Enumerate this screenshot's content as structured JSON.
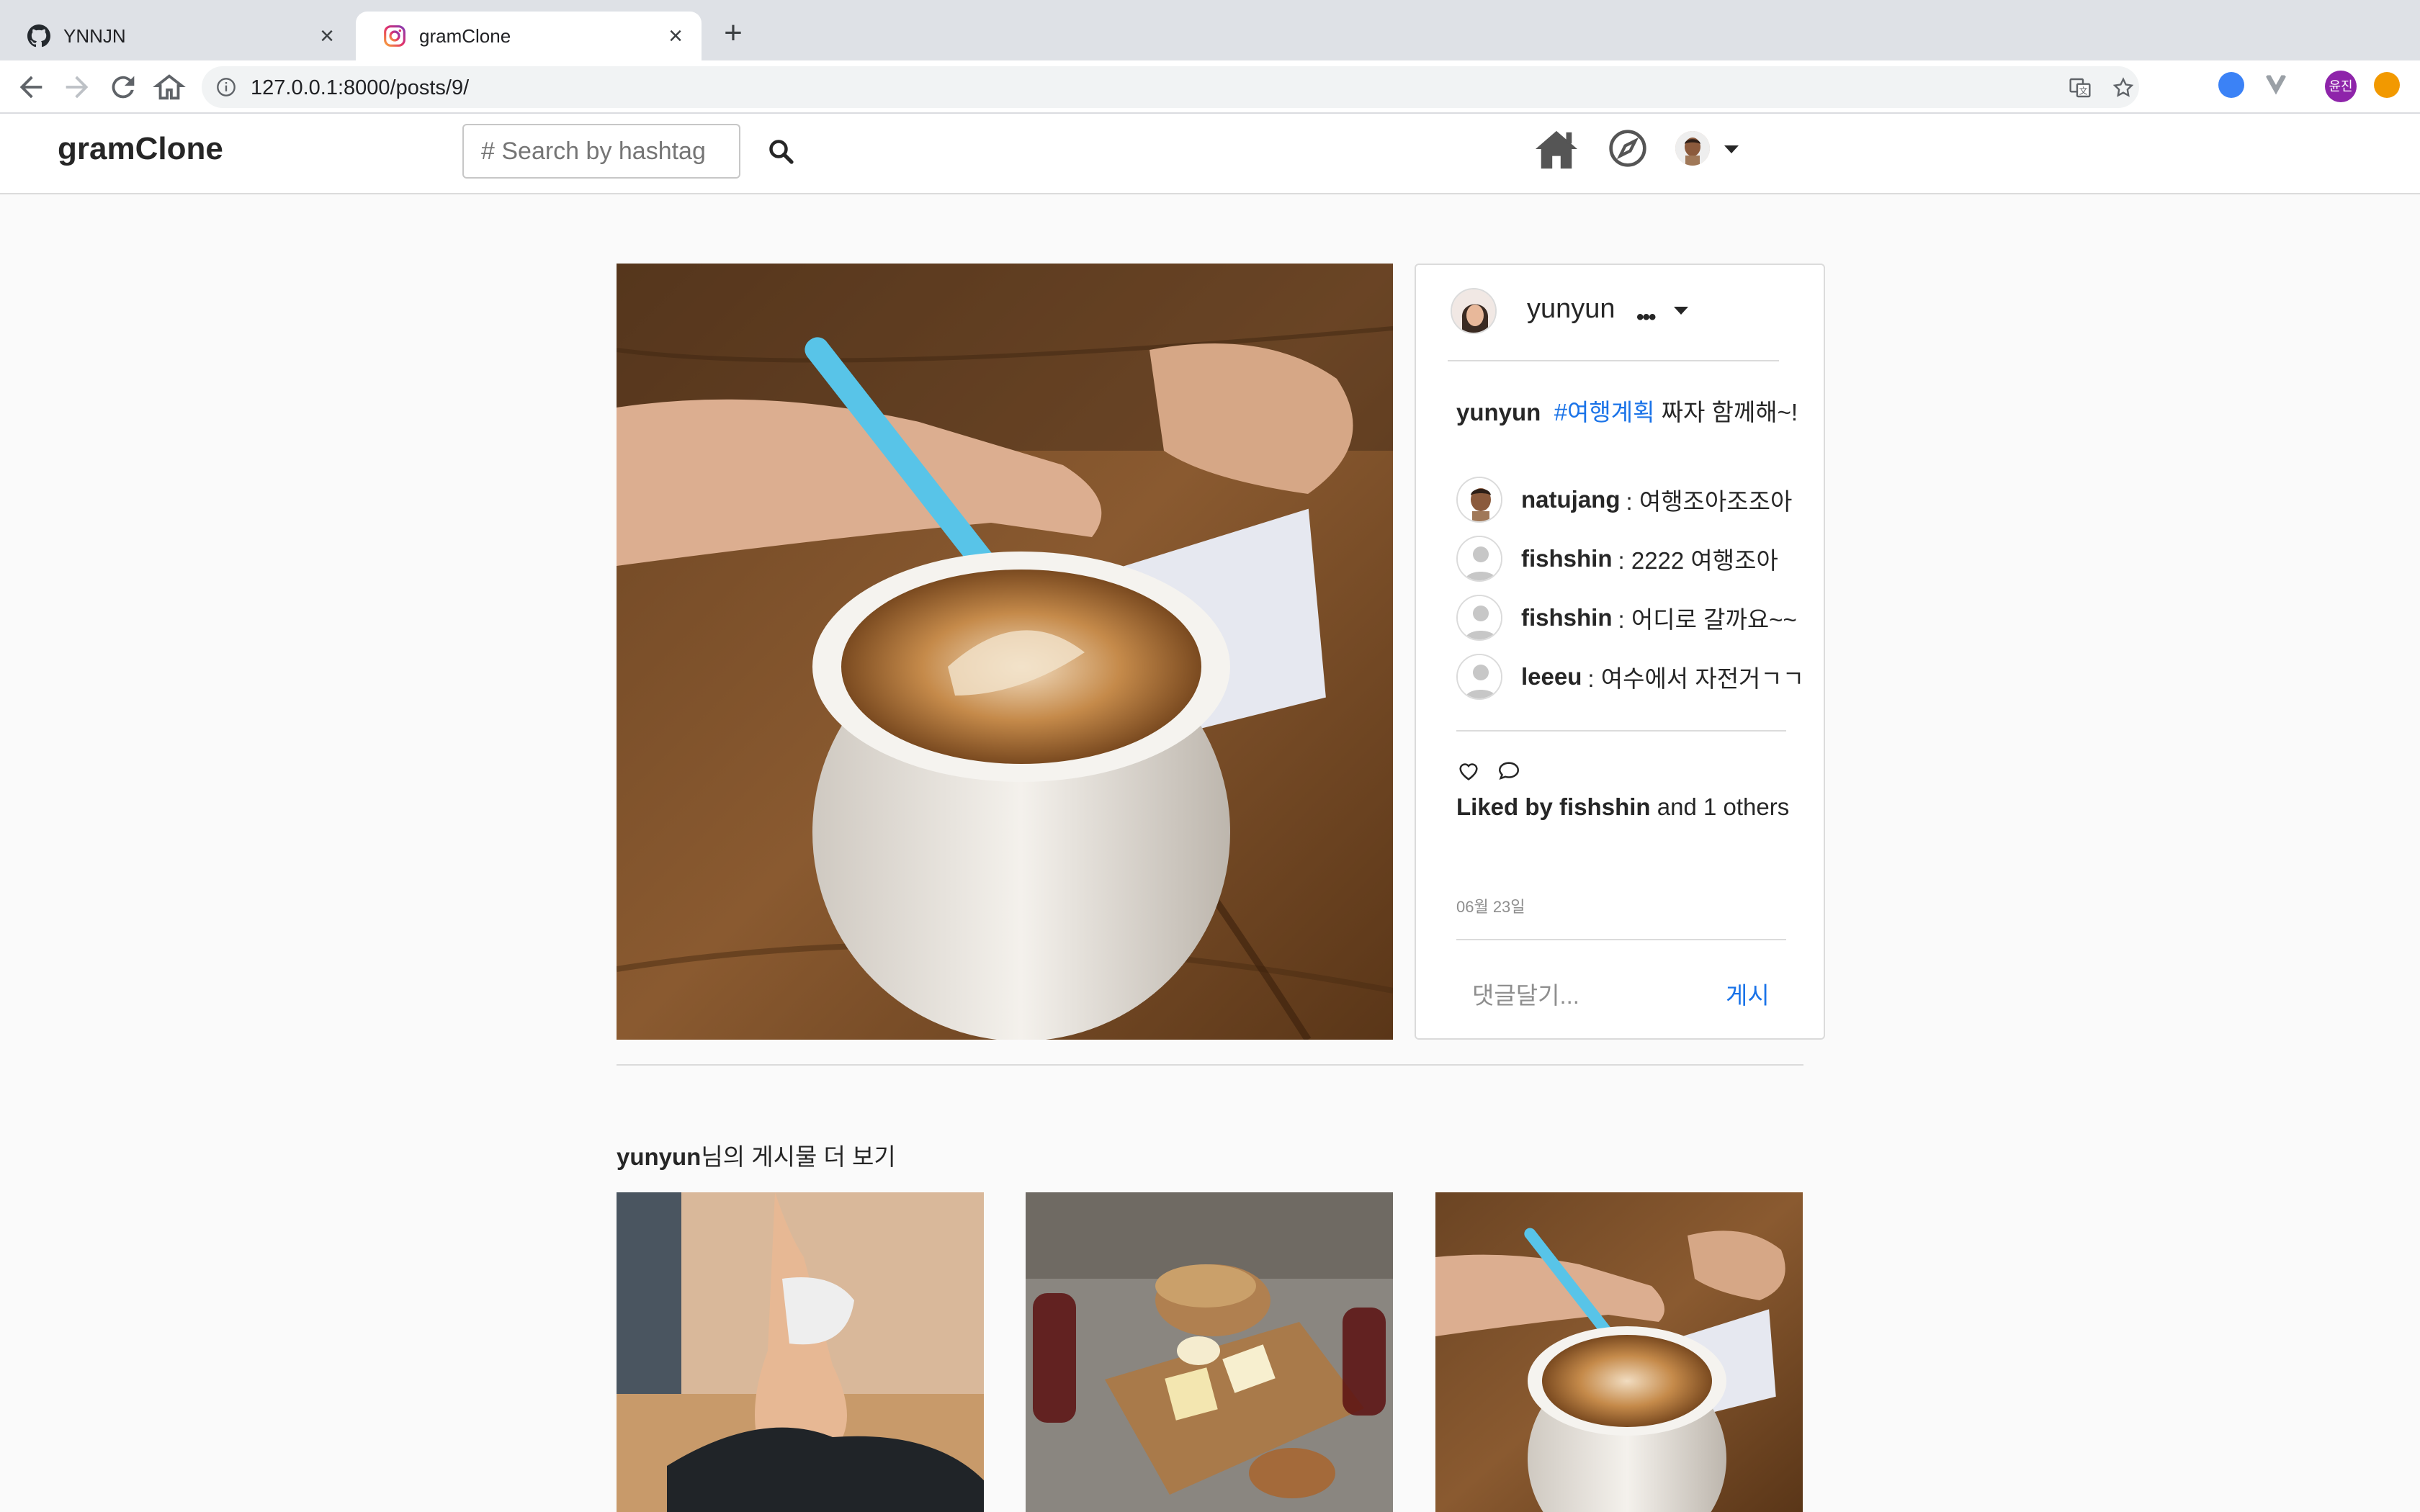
{
  "browser": {
    "tabs": [
      {
        "title": "YNNJN",
        "active": false,
        "icon": "github-icon"
      },
      {
        "title": "gramClone",
        "active": true,
        "icon": "instagram-icon"
      }
    ],
    "url": "127.0.0.1:8000/posts/9/",
    "profile_label": "윤진"
  },
  "navbar": {
    "brand": "gramClone",
    "search_placeholder": "# Search by hashtag"
  },
  "post": {
    "author": "yunyun",
    "caption": {
      "author": "yunyun",
      "hashtag": "#여행계획",
      "text": "짜자 함께해~!"
    },
    "comments": [
      {
        "user": "natujang",
        "text": ": 여행조아조조아",
        "avatar": "memoji"
      },
      {
        "user": "fishshin",
        "text": ": 2222 여행조아",
        "avatar": "default"
      },
      {
        "user": "fishshin",
        "text": ": 어디로 갈까요~~",
        "avatar": "default"
      },
      {
        "user": "leeeu",
        "text": ": 여수에서 자전거ㄱㄱ",
        "avatar": "default"
      }
    ],
    "likes": {
      "prefix": "Liked by",
      "user": "fishshin",
      "suffix": "and 1 others"
    },
    "date": "06월 23일",
    "comment_placeholder": "댓글달기...",
    "submit_label": "게시"
  },
  "more_posts": {
    "user": "yunyun",
    "title_suffix": "님의 게시물 더 보기",
    "thumbnails": [
      "yoga",
      "cheese-and-wine",
      "coffee-and-notes"
    ]
  },
  "colors": {
    "link": "#1a73e8",
    "border": "#dbdbdb",
    "background": "#fafafa"
  }
}
